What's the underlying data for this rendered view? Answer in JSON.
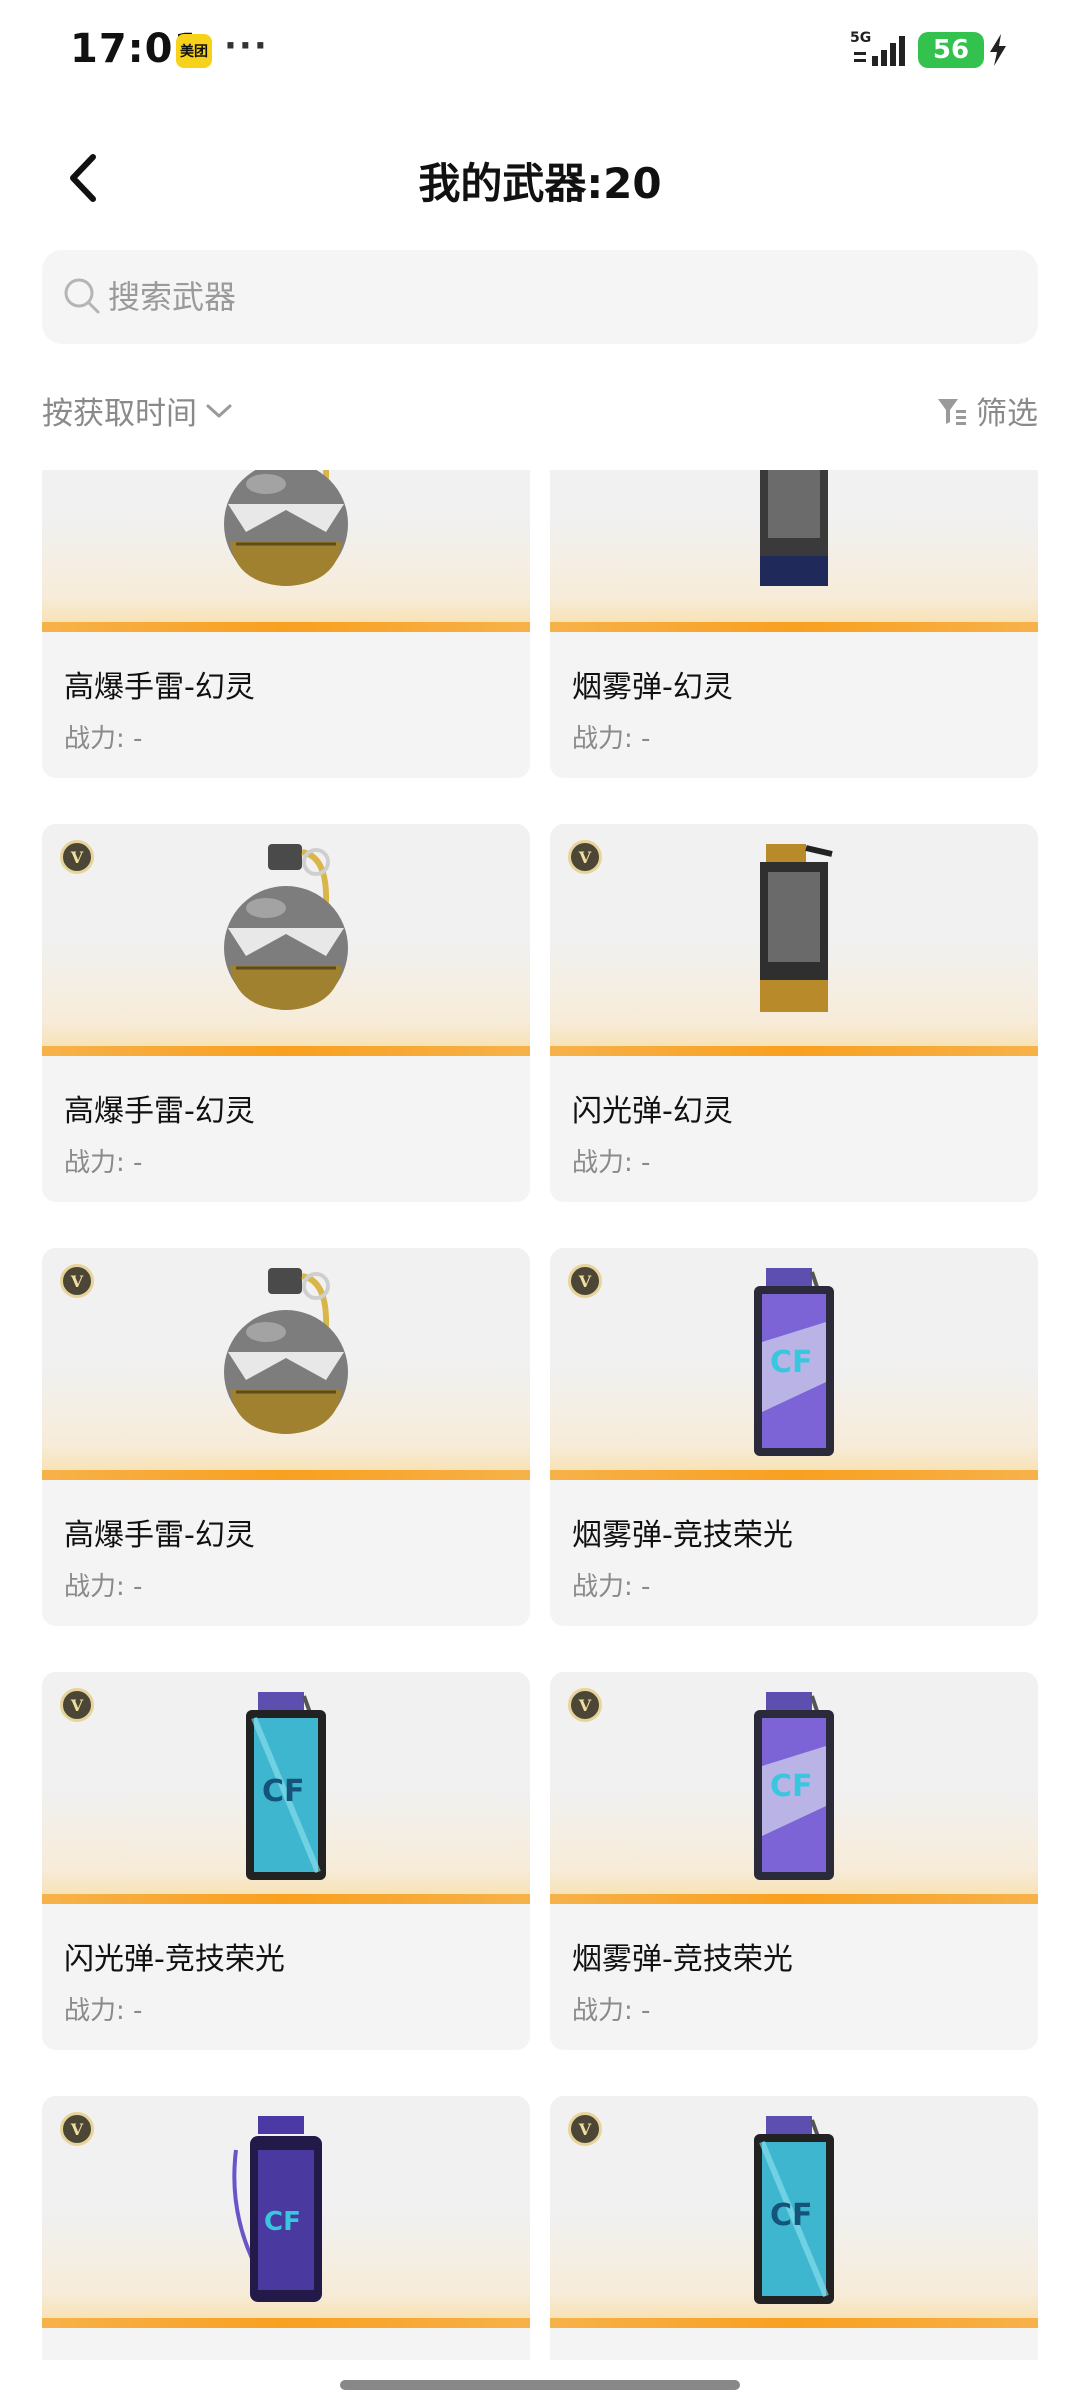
{
  "status_bar": {
    "time": "17:01",
    "app_badge": "美团",
    "more": "···",
    "network": "5G",
    "battery": "56",
    "battery_color": "#32c24d"
  },
  "header": {
    "title": "我的武器:20",
    "back_icon": "chevron-left-icon"
  },
  "search": {
    "placeholder": "搜索武器",
    "value": ""
  },
  "toolbar": {
    "sort_label": "按获取时间",
    "filter_label": "筛选"
  },
  "colors": {
    "accent_orange": "#f8a020",
    "card_bg": "#f4f4f4",
    "muted_text": "#8a8a8a"
  },
  "weapons": [
    {
      "name": "高爆手雷-幻灵",
      "power": "战力: -",
      "type": "grenade",
      "vip": false
    },
    {
      "name": "烟雾弹-幻灵",
      "power": "战力: -",
      "type": "canister-dark",
      "vip": false
    },
    {
      "name": "高爆手雷-幻灵",
      "power": "战力: -",
      "type": "grenade",
      "vip": true,
      "vip_label": "V"
    },
    {
      "name": "闪光弹-幻灵",
      "power": "战力: -",
      "type": "canister-gold",
      "vip": true,
      "vip_label": "V"
    },
    {
      "name": "高爆手雷-幻灵",
      "power": "战力: -",
      "type": "grenade",
      "vip": true,
      "vip_label": "V"
    },
    {
      "name": "烟雾弹-竞技荣光",
      "power": "战力: -",
      "type": "canister-purple",
      "vip": true,
      "vip_label": "V"
    },
    {
      "name": "闪光弹-竞技荣光",
      "power": "战力: -",
      "type": "canister-blue",
      "vip": true,
      "vip_label": "V"
    },
    {
      "name": "烟雾弹-竞技荣光",
      "power": "战力: -",
      "type": "canister-purple",
      "vip": true,
      "vip_label": "V"
    },
    {
      "name": "",
      "power": "",
      "type": "canister-violet",
      "vip": true,
      "vip_label": "V"
    },
    {
      "name": "",
      "power": "",
      "type": "canister-blue",
      "vip": true,
      "vip_label": "V"
    }
  ]
}
